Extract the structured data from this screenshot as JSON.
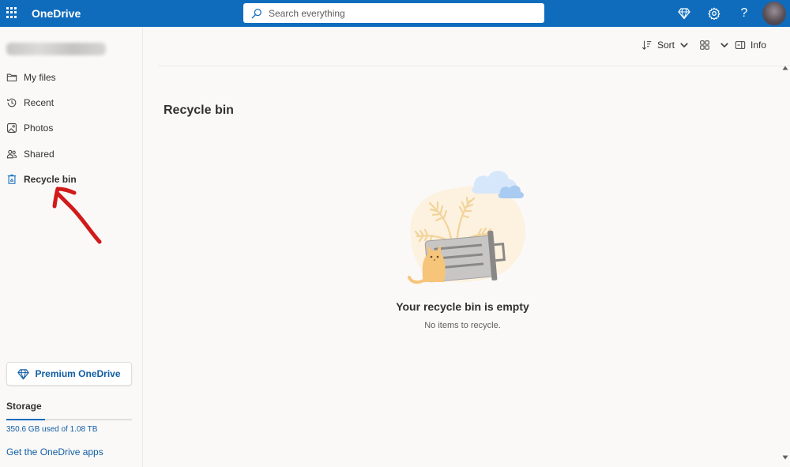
{
  "app": {
    "title": "OneDrive"
  },
  "search": {
    "placeholder": "Search everything"
  },
  "topbar": {
    "help_label": "?"
  },
  "sidebar": {
    "items": [
      {
        "label": "My files",
        "icon": "folder-icon"
      },
      {
        "label": "Recent",
        "icon": "history-icon"
      },
      {
        "label": "Photos",
        "icon": "image-icon"
      },
      {
        "label": "Shared",
        "icon": "people-icon"
      },
      {
        "label": "Recycle bin",
        "icon": "recycle-bin-icon",
        "active": true
      }
    ],
    "premium_label": "Premium OneDrive",
    "storage_title": "Storage",
    "storage_text": "350.6 GB used of 1.08 TB",
    "storage_fraction": 0.31,
    "apps_link": "Get the OneDrive apps"
  },
  "commandbar": {
    "sort_label": "Sort",
    "info_label": "Info"
  },
  "main": {
    "title": "Recycle bin",
    "empty_title": "Your recycle bin is empty",
    "empty_subtitle": "No items to recycle."
  },
  "colors": {
    "brand": "#0f6cbd",
    "link": "#115ea3",
    "annotation": "#d11a1a"
  }
}
